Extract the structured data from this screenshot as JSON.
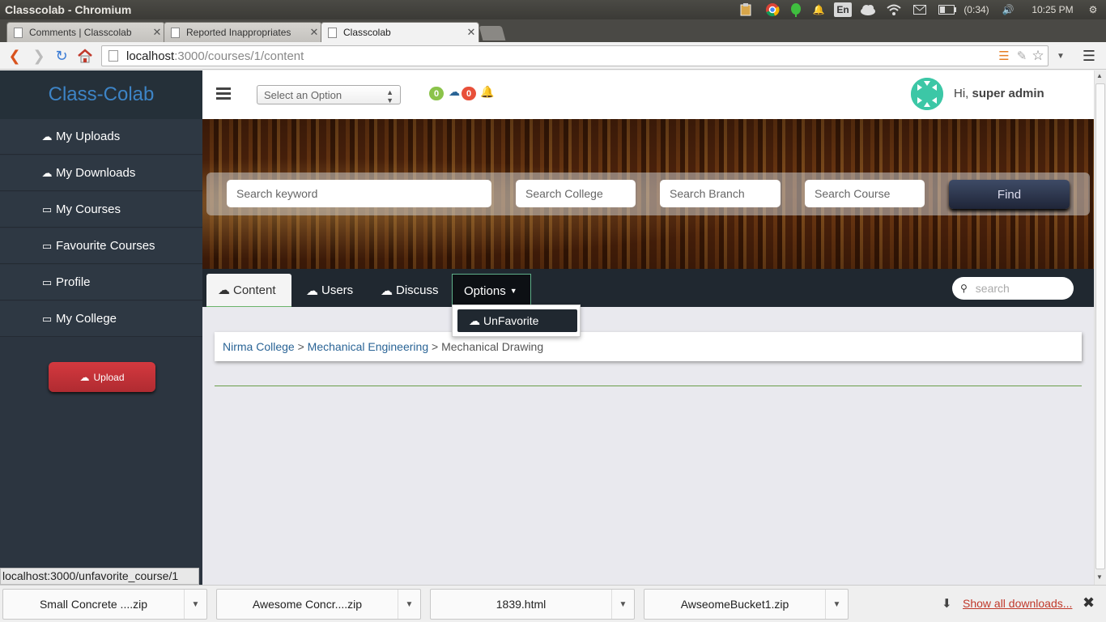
{
  "os": {
    "window_title": "Classcolab - Chromium",
    "lang": "En",
    "battery": "(0:34)",
    "time": "10:25 PM"
  },
  "tabs": [
    {
      "label": "Comments | Classcolab"
    },
    {
      "label": "Reported Inappropriates"
    },
    {
      "label": "Classcolab"
    }
  ],
  "browser": {
    "url_host": "localhost",
    "url_path": ":3000/courses/1/content"
  },
  "sidebar": {
    "brand": "Class-Colab",
    "items": [
      {
        "label": "My Uploads",
        "icon": "cloud-upload-icon"
      },
      {
        "label": "My Downloads",
        "icon": "cloud-download-icon"
      },
      {
        "label": "My Courses",
        "icon": "book-icon"
      },
      {
        "label": "Favourite Courses",
        "icon": "book-icon"
      },
      {
        "label": "Profile",
        "icon": "book-icon"
      },
      {
        "label": "My College",
        "icon": "book-icon"
      }
    ],
    "upload_label": "Upload"
  },
  "header": {
    "select_placeholder": "Select an Option",
    "badge_green": "0",
    "badge_red": "0",
    "greeting_prefix": "Hi,",
    "username": "super admin"
  },
  "search": {
    "keyword": "Search keyword",
    "college": "Search College",
    "branch": "Search Branch",
    "course": "Search Course",
    "find_label": "Find"
  },
  "page_tabs": [
    {
      "label": "Content",
      "icon": "cloud-icon"
    },
    {
      "label": "Users",
      "icon": "cloud-icon"
    },
    {
      "label": "Discuss",
      "icon": "cloud-icon"
    },
    {
      "label": "Options"
    }
  ],
  "tab_search_placeholder": "search",
  "dropdown": {
    "item": "UnFavorite"
  },
  "breadcrumb": {
    "college": "Nirma College",
    "sep": ">",
    "branch": "Mechanical Engineering",
    "course": "Mechanical Drawing"
  },
  "status_url": "localhost:3000/unfavorite_course/1",
  "downloads": {
    "items": [
      "Small Concrete ....zip",
      "Awesome Concr....zip",
      "1839.html",
      "AwseomeBucket1.zip"
    ],
    "show_all": "Show all downloads..."
  },
  "colors": {
    "sidebar": "#2c3540",
    "brand_text": "#3d84c6",
    "upload_button": "#c0333a",
    "tab_bar": "#202830",
    "badge_green": "#8bc34a",
    "badge_red": "#e8503a",
    "link": "#2a6496"
  }
}
